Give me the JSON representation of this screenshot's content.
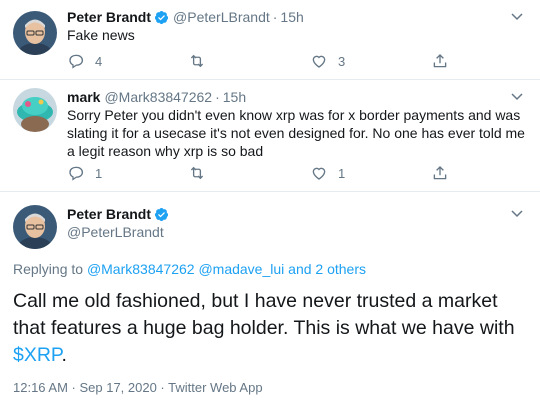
{
  "tweet1": {
    "display_name": "Peter Brandt",
    "handle": "@PeterLBrandt",
    "separator": "·",
    "time": "15h",
    "text": "Fake news",
    "reply_count": "4",
    "retweet_count": "",
    "like_count": "3"
  },
  "tweet2": {
    "display_name": "mark",
    "handle": "@Mark83847262",
    "separator": "·",
    "time": "15h",
    "text": "Sorry Peter you didn't even know xrp was for x border payments and was slating it for a usecase it's not even designed for. No one has ever told me a legit reason why xrp is so bad",
    "reply_count": "1",
    "retweet_count": "",
    "like_count": "1"
  },
  "main_tweet": {
    "display_name": "Peter Brandt",
    "handle": "@PeterLBrandt",
    "replying_prefix": "Replying to",
    "replying_user1": "@Mark83847262",
    "replying_user2": "@madave_lui",
    "replying_others": "and 2 others",
    "text_before": "Call me old fashioned, but I have never trusted a market that features a huge bag holder. This is what we have with ",
    "cashtag": "$XRP",
    "text_after": ".",
    "timestamp": "12:16 AM · Sep 17, 2020 · Twitter Web App"
  },
  "colors": {
    "link": "#1da1f2",
    "muted": "#657786",
    "text": "#14171a",
    "verified": "#1da1f2",
    "divider": "#e6ecf0"
  },
  "icons": {
    "verified": "verified-badge-icon",
    "reply": "reply-icon",
    "retweet": "retweet-icon",
    "like": "heart-icon",
    "share": "share-icon",
    "more": "chevron-down-icon"
  }
}
